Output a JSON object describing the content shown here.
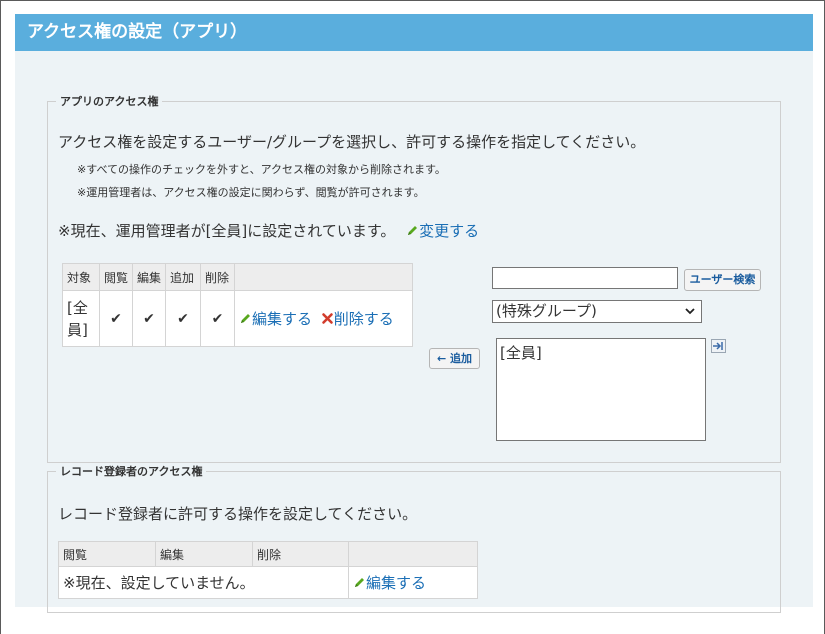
{
  "page_title": "アクセス権の設定（アプリ）",
  "app_access": {
    "legend": "アプリのアクセス権",
    "description": "アクセス権を設定するユーザー/グループを選択し、許可する操作を指定してください。",
    "note1": "※すべての操作のチェックを外すと、アクセス権の対象から削除されます。",
    "note2": "※運用管理者は、アクセス権の設定に関わらず、閲覧が許可されます。",
    "admin_status": "※現在、運用管理者が[全員]に設定されています。",
    "change_link": "変更する",
    "table": {
      "headers": [
        "対象",
        "閲覧",
        "編集",
        "追加",
        "削除"
      ],
      "row": {
        "target": "[全員]",
        "checks": [
          "✔",
          "✔",
          "✔",
          "✔"
        ],
        "edit_link": "編集する",
        "delete_link": "削除する"
      }
    },
    "add_button": "← 追加",
    "search_value": "",
    "search_button": "ユーザー検索",
    "group_select": "(特殊グループ)",
    "candidates": [
      "[全員]"
    ],
    "colors": {
      "check": "#58a81e",
      "delete_x": "#d23c2c",
      "link": "#1a6eb5",
      "title_bar": "#5aaedd"
    }
  },
  "creator_access": {
    "legend": "レコード登録者のアクセス権",
    "description": "レコード登録者に許可する操作を設定してください。",
    "table": {
      "headers": [
        "閲覧",
        "編集",
        "削除",
        ""
      ],
      "status": "※現在、設定していません。",
      "edit_link": "編集する"
    }
  }
}
